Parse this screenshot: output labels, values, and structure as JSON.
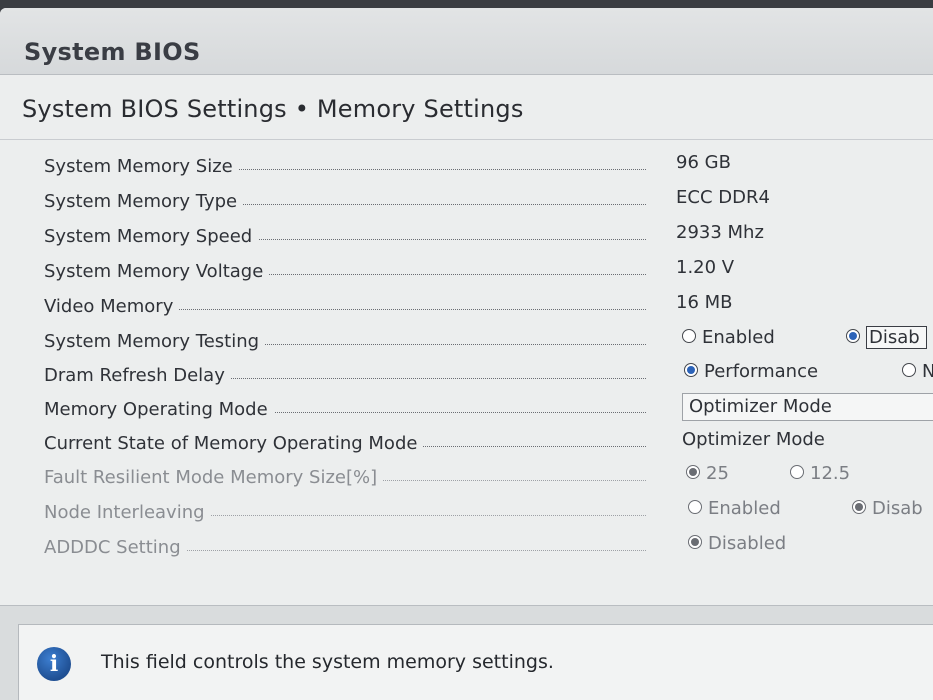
{
  "app_title": "System BIOS",
  "breadcrumb": "System BIOS Settings • Memory Settings",
  "rows": [
    {
      "label": "System Memory Size",
      "value": "96 GB"
    },
    {
      "label": "System Memory Type",
      "value": "ECC DDR4"
    },
    {
      "label": "System Memory Speed",
      "value": "2933 Mhz"
    },
    {
      "label": "System Memory Voltage",
      "value": "1.20 V"
    },
    {
      "label": "Video Memory",
      "value": "16 MB"
    },
    {
      "label": "System Memory Testing",
      "options": [
        "Enabled",
        "Disab"
      ],
      "selected": "Disab"
    },
    {
      "label": "Dram Refresh Delay",
      "options": [
        "Performance",
        "N"
      ],
      "selected": "Performance"
    },
    {
      "label": "Memory Operating Mode",
      "select_value": "Optimizer Mode"
    },
    {
      "label": "Current State of Memory Operating Mode",
      "value": "Optimizer Mode"
    },
    {
      "label": "Fault Resilient Mode Memory Size[%]",
      "options": [
        "25",
        "12.5"
      ],
      "selected": "25"
    },
    {
      "label": "Node Interleaving",
      "options": [
        "Enabled",
        "Disab"
      ],
      "selected": "Disab"
    },
    {
      "label": "ADDDC Setting",
      "options": [
        "Disabled"
      ],
      "selected": "Disabled"
    }
  ],
  "help_text": "This field controls the system memory settings.",
  "icons": {
    "info": "info-icon"
  },
  "colors": {
    "accent": "#2c63b8",
    "background": "#eceeee"
  }
}
